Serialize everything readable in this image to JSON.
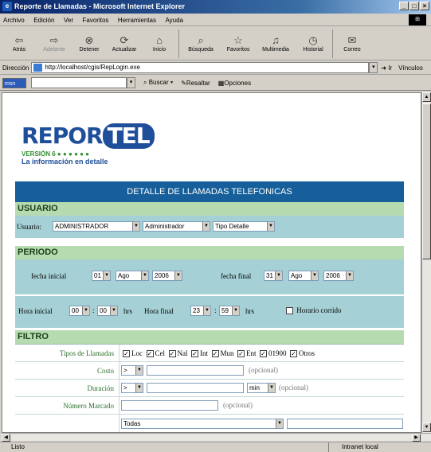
{
  "window": {
    "title": "Reporte de Llamadas - Microsoft Internet Explorer"
  },
  "menu": [
    "Archivo",
    "Edición",
    "Ver",
    "Favoritos",
    "Herramientas",
    "Ayuda"
  ],
  "toolbar": {
    "back": "Atrás",
    "forward": "Adelante",
    "stop": "Detener",
    "refresh": "Actualizar",
    "home": "Inicio",
    "search": "Búsqueda",
    "favorites": "Favoritos",
    "media": "Multimedia",
    "history": "Historial",
    "mail": "Correo"
  },
  "address": {
    "label": "Dirección",
    "url": "http://localhost/cgis/RepLogin.exe",
    "go": "Ir",
    "links": "Vínculos"
  },
  "linksbar": {
    "msn": "msn",
    "buscar": "Buscar",
    "resaltar": "Resaltar",
    "opciones": "Opciones"
  },
  "logo": {
    "rep": "REPOR",
    "tel": "TEL",
    "version": "VERSIÓN 6",
    "tagline": "La información en detalle"
  },
  "page": {
    "header": "DETALLE DE LLAMADAS TELEFONICAS",
    "usuario": {
      "section": "USUARIO",
      "label": "Usuario:",
      "user": "ADMINISTRADOR",
      "role": "Administrador",
      "tipo": "Tipo Detalle"
    },
    "periodo": {
      "section": "PERIODO",
      "fecha_inicial_label": "fecha inicial",
      "fi_dia": "01",
      "fi_mes": "Ago",
      "fi_anio": "2006",
      "fecha_final_label": "fecha final",
      "ff_dia": "31",
      "ff_mes": "Ago",
      "ff_anio": "2006",
      "hora_inicial_label": "Hora inicial",
      "hi_h": "00",
      "hi_m": "00",
      "hrs": "hrs",
      "hora_final_label": "Hora final",
      "hf_h": "23",
      "hf_m": "59",
      "horario_corrido": "Horario corrido"
    },
    "filtro": {
      "section": "FILTRO",
      "tipos_label": "Tipos de Llamadas",
      "tipos": [
        "Loc",
        "Cel",
        "Nal",
        "Int",
        "Mun",
        "Ent",
        "01900",
        "Otros"
      ],
      "costo_label": "Costo",
      "costo_op": ">",
      "duracion_label": "Duración",
      "duracion_op": ">",
      "duracion_unit": "min",
      "opcional": "(opcional)",
      "numero_label": "Número Marcado",
      "todas": "Todas"
    }
  },
  "status": {
    "left": "Listo",
    "zone": "Intranet local"
  }
}
